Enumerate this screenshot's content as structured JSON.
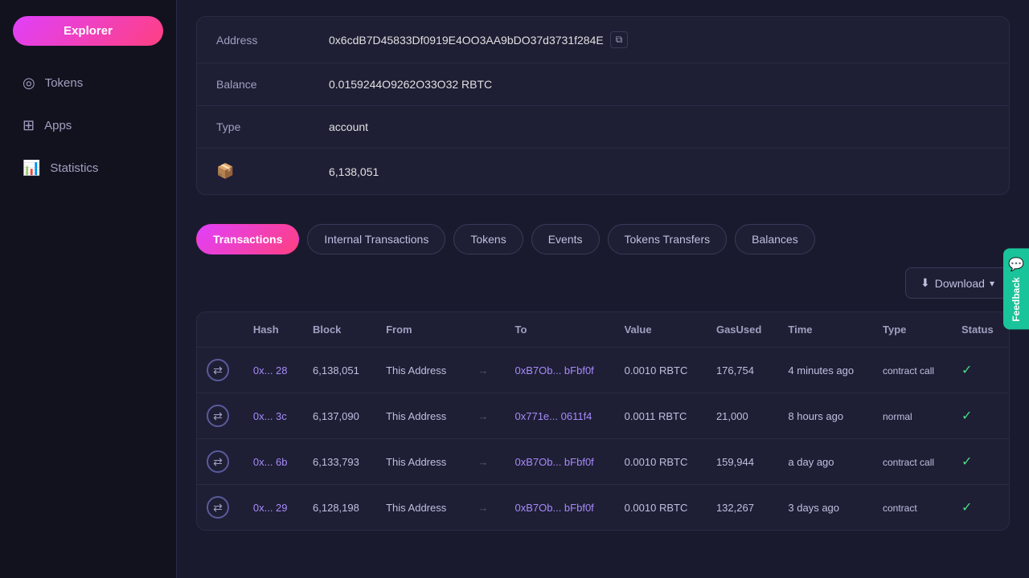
{
  "sidebar": {
    "logo_label": "Explorer",
    "items": [
      {
        "id": "tokens",
        "label": "Tokens",
        "icon": "◎"
      },
      {
        "id": "apps",
        "label": "Apps",
        "icon": "⊞"
      },
      {
        "id": "statistics",
        "label": "Statistics",
        "icon": "📊"
      }
    ]
  },
  "info": {
    "address_label": "Address",
    "address_value": "0x6cdB7D45833Df0919E4OO3AA9bDO37d3731f284E",
    "balance_label": "Balance",
    "balance_value": "0.0159244O9262O33O32 RBTC",
    "type_label": "Type",
    "type_value": "account",
    "count_value": "6,138,051"
  },
  "tabs": [
    {
      "id": "transactions",
      "label": "Transactions",
      "active": true
    },
    {
      "id": "internal-transactions",
      "label": "Internal Transactions",
      "active": false
    },
    {
      "id": "tokens",
      "label": "Tokens",
      "active": false
    },
    {
      "id": "events",
      "label": "Events",
      "active": false
    },
    {
      "id": "tokens-transfers",
      "label": "Tokens Transfers",
      "active": false
    },
    {
      "id": "balances",
      "label": "Balances",
      "active": false
    }
  ],
  "download_label": "Download",
  "table": {
    "headers": [
      "",
      "Hash",
      "Block",
      "From",
      "",
      "To",
      "Value",
      "GasUsed",
      "Time",
      "Type",
      "Status"
    ],
    "rows": [
      {
        "hash": "0x... 28",
        "block": "6,138,051",
        "from": "This Address",
        "to": "0xB7Ob... bFbf0f",
        "value": "0.0010 RBTC",
        "gas_used": "176,754",
        "time": "4 minutes ago",
        "type": "contract call",
        "status": "✓"
      },
      {
        "hash": "0x... 3c",
        "block": "6,137,090",
        "from": "This Address",
        "to": "0x771e... 0611f4",
        "value": "0.0011 RBTC",
        "gas_used": "21,000",
        "time": "8 hours ago",
        "type": "normal",
        "status": "✓"
      },
      {
        "hash": "0x... 6b",
        "block": "6,133,793",
        "from": "This Address",
        "to": "0xB7Ob... bFbf0f",
        "value": "0.0010 RBTC",
        "gas_used": "159,944",
        "time": "a day ago",
        "type": "contract call",
        "status": "✓"
      },
      {
        "hash": "0x... 29",
        "block": "6,128,198",
        "from": "This Address",
        "to": "0xB7Ob... bFbf0f",
        "value": "0.0010 RBTC",
        "gas_used": "132,267",
        "time": "3 days ago",
        "type": "contract",
        "status": "✓"
      }
    ]
  },
  "feedback": {
    "label": "Feedback",
    "icon": "💬"
  }
}
